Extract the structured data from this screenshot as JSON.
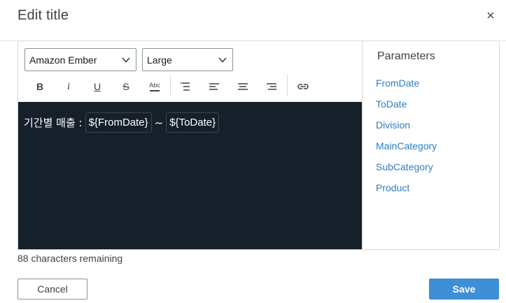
{
  "dialog": {
    "title": "Edit title",
    "close_icon": "close-icon"
  },
  "toolbar": {
    "font_select_value": "Amazon Ember",
    "size_select_value": "Large",
    "buttons": {
      "bold": "B",
      "italic": "i",
      "underline": "U",
      "strikethrough": "S",
      "text_color": "Abc"
    },
    "icons": [
      "bold-icon",
      "italic-icon",
      "underline-icon",
      "strikethrough-icon",
      "text-color-icon",
      "list-icon",
      "align-left-icon",
      "align-center-icon",
      "align-right-icon",
      "link-icon"
    ]
  },
  "editor": {
    "prefix": "기간별 매출 :",
    "token1": "${FromDate}",
    "separator": "~",
    "token2": "${ToDate}",
    "background": "#16202b"
  },
  "parameters": {
    "title": "Parameters",
    "items": [
      "FromDate",
      "ToDate",
      "Division",
      "MainCategory",
      "SubCategory",
      "Product"
    ]
  },
  "footer": {
    "remaining": "88 characters remaining",
    "cancel_label": "Cancel",
    "save_label": "Save",
    "save_color": "#3f8fd8"
  }
}
